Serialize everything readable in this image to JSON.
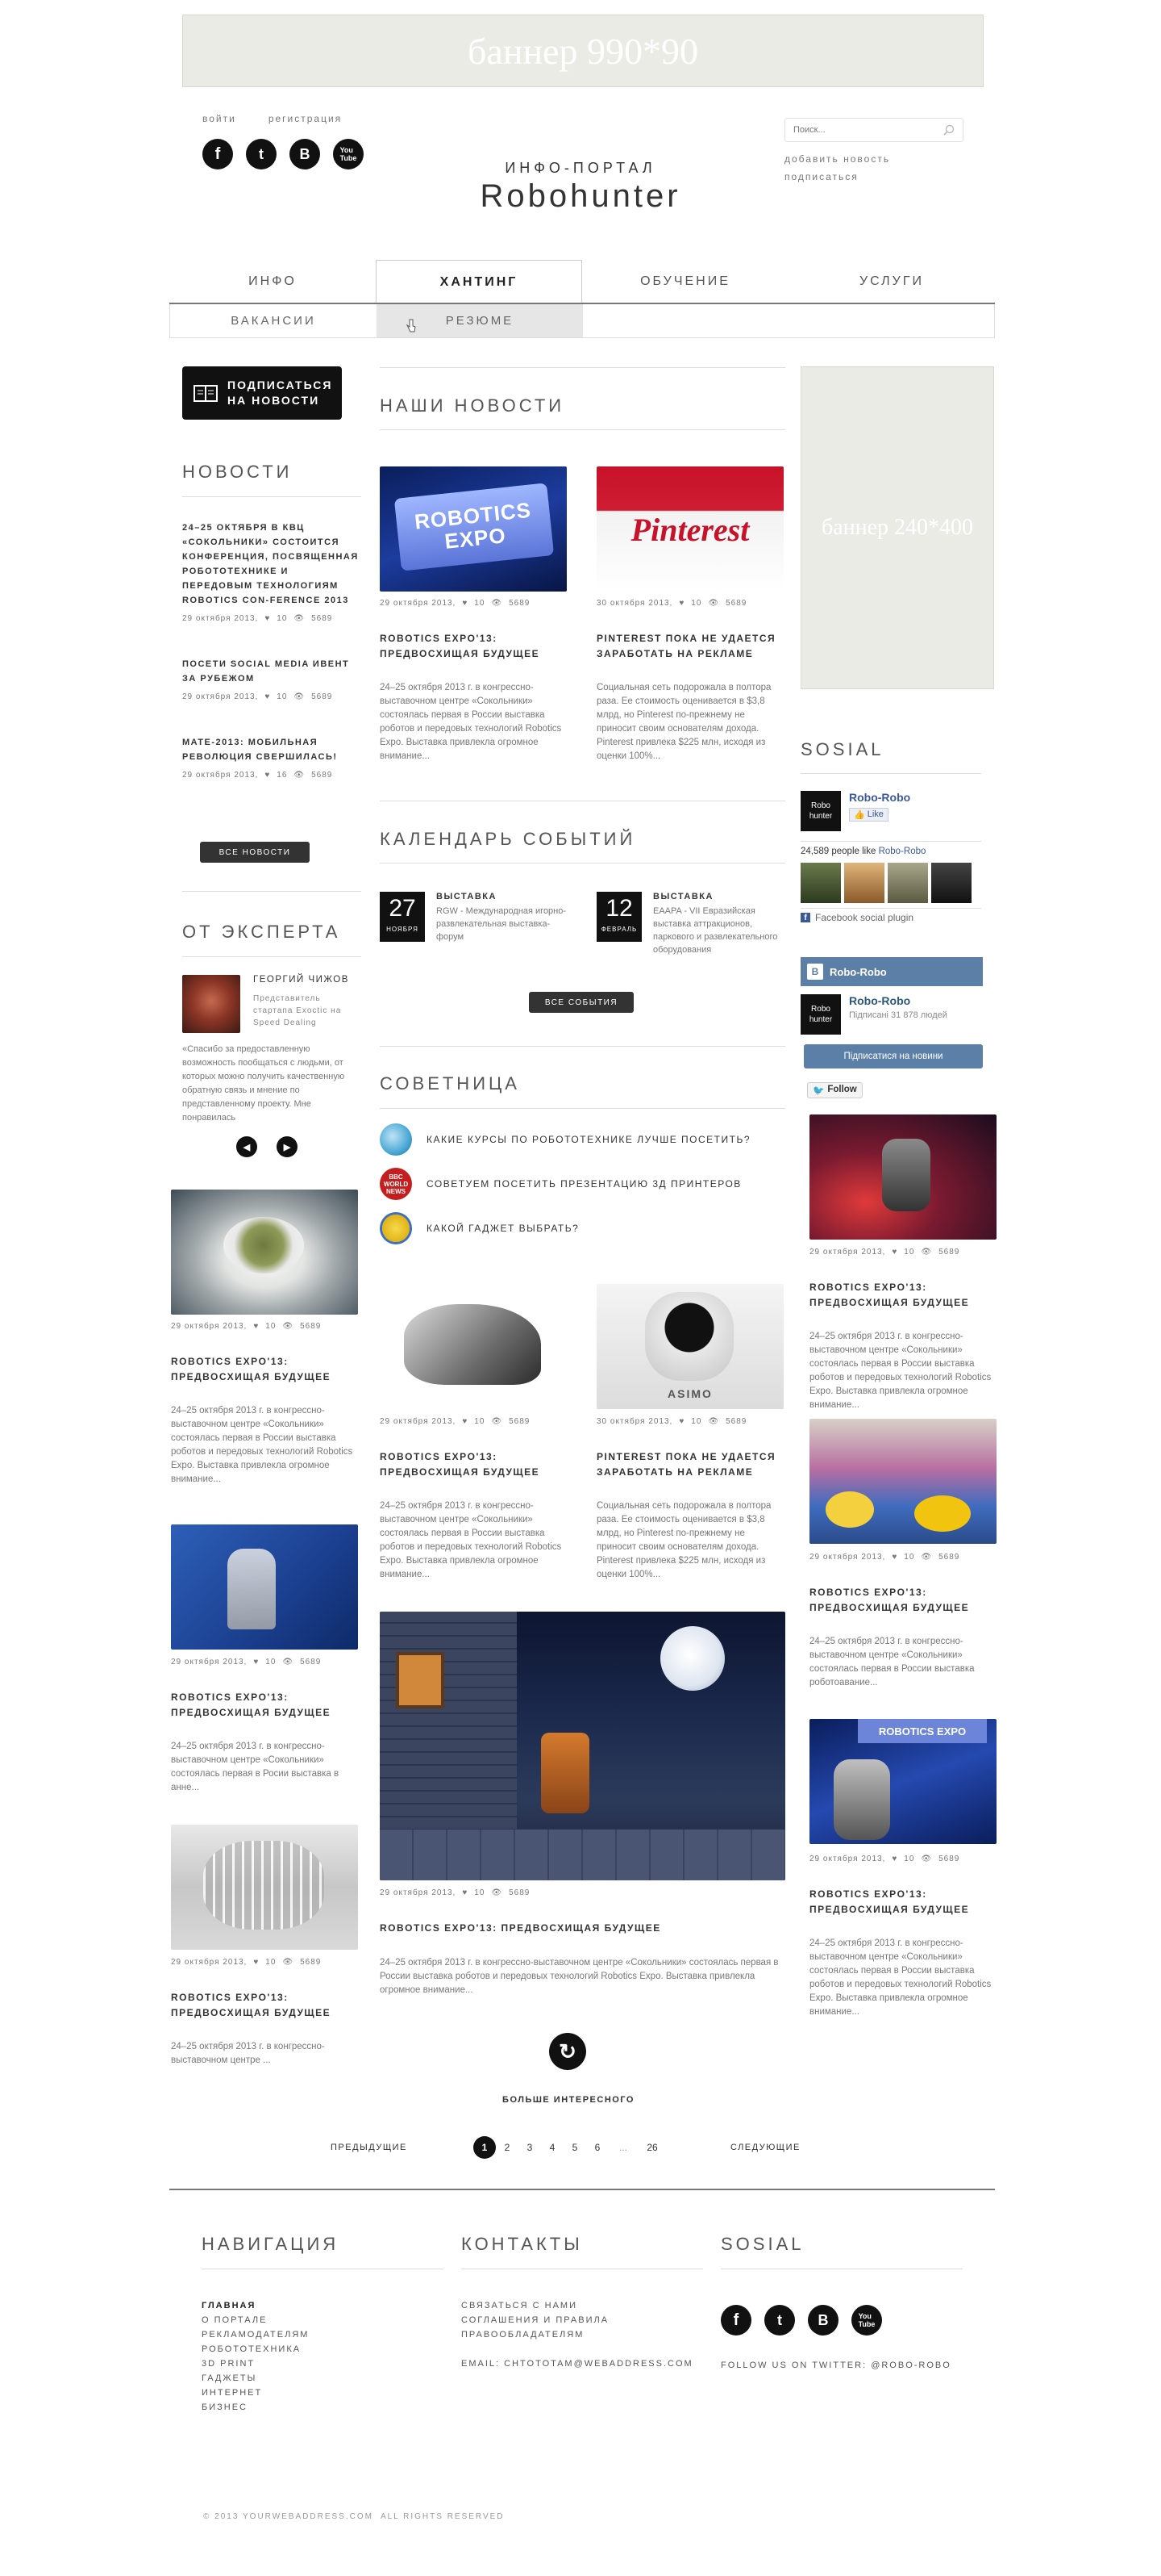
{
  "top_banner": "баннер 990*90",
  "side_banner": "баннер 240*400",
  "auth": {
    "login": "войти",
    "register": "регистрация"
  },
  "social_icons": [
    "facebook-icon",
    "twitter-icon",
    "vk-icon",
    "youtube-icon"
  ],
  "logo": {
    "sub": "ИНФО-ПОРТАЛ",
    "main": "Robohunter"
  },
  "search": {
    "placeholder": "Поиск..."
  },
  "top_links": [
    "добавить новость",
    "подписаться"
  ],
  "nav": {
    "items": [
      "ИНФО",
      "ХАНТИНГ",
      "ОБУЧЕНИЕ",
      "УСЛУГИ"
    ],
    "sub": [
      "ВАКАНСИИ",
      "РЕЗЮМЕ"
    ]
  },
  "subscribe_btn": [
    "ПОДПИСАТЬСЯ",
    "НА НОВОСТИ"
  ],
  "left": {
    "news_title": "НОВОСТИ",
    "news": [
      {
        "title": "24–25 октября в КВЦ «Сокольники» состоится конференция, посвященная робототехнике и передовым технологиям Robotics Con-ference 2013",
        "date": "29 октября 2013,",
        "likes": "10",
        "views": "5689"
      },
      {
        "title": "Посети Social Media Ивент за рубежом",
        "date": "29 октября 2013,",
        "likes": "10",
        "views": "5689"
      },
      {
        "title": "MATE-2013: мобильная революция свершилась!",
        "date": "29 октября 2013,",
        "likes": "16",
        "views": "5689"
      }
    ],
    "all_news": "ВСЕ НОВОСТИ",
    "expert_title": "ОТ ЭКСПЕРТА",
    "expert": {
      "name": "ГЕОРГИЙ ЧИЖОВ",
      "role": "Представитель стартапа Exoctic на Speed Dealing",
      "quote": "«Спасибо за предоставленную возможность пообщаться с людьми, от которых можно получить качественную обратную связь и мнение по представленному проекту. Мне понравилась"
    },
    "posts": [
      {
        "date": "29 октября 2013,",
        "likes": "10",
        "views": "5689",
        "title": "ROBOTICS EXPO'13: ПРЕДВОСХИЩАЯ БУДУЩЕЕ",
        "text": "24–25 октября 2013 г. в конгрессно-выставочном центре «Сокольники» состоялась первая в России выставка роботов и передовых технологий Robotics Expo. Выставка привлекла огромное внимание..."
      },
      {
        "date": "29 октября 2013,",
        "likes": "10",
        "views": "5689",
        "title": "ROBOTICS EXPO'13: ПРЕДВОСХИЩАЯ БУДУЩЕЕ",
        "text": "24–25 октября 2013 г. в конгрессно-выставочном центре «Сокольники» состоялась первая в Росии выставка в анне..."
      },
      {
        "date": "29 октября 2013,",
        "likes": "10",
        "views": "5689",
        "title": "ROBOTICS EXPO'13: ПРЕДВОСХИЩАЯ БУДУЩЕЕ",
        "text": "24–25 октября 2013 г. в конгрессно-выставочном центре ..."
      }
    ]
  },
  "center": {
    "news_title": "НАШИ НОВОСТИ",
    "posts": [
      {
        "date": "29 октября 2013,",
        "likes": "10",
        "views": "5689",
        "title": "ROBOTICS EXPO'13: ПРЕДВОСХИЩАЯ БУДУЩЕЕ",
        "text": "24–25 октября 2013 г. в конгрессно-выставочном центре «Сокольники» состоялась первая в России выставка роботов и передовых технологий Robotics Expo. Выставка привлекла огромное внимание...",
        "img_text": "ROBOTICS EXPO"
      },
      {
        "date": "30 октября 2013,",
        "likes": "10",
        "views": "5689",
        "title": "PINTEREST ПОКА НЕ УДАЕТСЯ ЗАРАБОТАТЬ НА РЕКЛАМЕ",
        "text": "Социальная сеть подорожала в полтора раза. Ее стоимость оценивается в $3,8 млрд, но Pinterest по-прежнему не приносит своим основателям дохода. Pinterest привлека $225 млн, исходя из оценки 100%...",
        "img_text": "Pinterest"
      }
    ],
    "calendar_title": "КАЛЕНДАРЬ СОБЫТИЙ",
    "events": [
      {
        "day": "27",
        "month": "НОЯБРЯ",
        "type": "ВЫСТАВКА",
        "desc": "RGW - Международная игорно-развлекательная выставка-форум"
      },
      {
        "day": "12",
        "month": "ФЕВРАЛЬ",
        "type": "ВЫСТАВКА",
        "desc": "EAAPA - VII Евразийская выставка аттракционов, паркового и развлекательного оборудования"
      }
    ],
    "all_events": "ВСЕ СОБЫТИЯ",
    "advice_title": "СОВЕТНИЦА",
    "advice": [
      "КАКИЕ КУРСЫ ПО РОБОТОТЕХНИКЕ ЛУЧШЕ ПОСЕТИТЬ?",
      "СОВЕТУЕМ ПОСЕТИТЬ ПРЕЗЕНТАЦИЮ 3Д ПРИНТЕРОВ",
      "КАКОЙ ГАДЖЕТ ВЫБРАТЬ?"
    ],
    "posts2": [
      {
        "date": "29 октября 2013,",
        "likes": "10",
        "views": "5689",
        "title": "ROBOTICS EXPO'13: ПРЕДВОСХИЩАЯ БУДУЩЕЕ",
        "text": "24–25 октября 2013 г. в конгрессно-выставочном центре «Сокольники» состоялась первая в России выставка роботов и передовых технологий Robotics Expo. Выставка привлекла огромное внимание..."
      },
      {
        "date": "30 октября 2013,",
        "likes": "10",
        "views": "5689",
        "title": "PINTEREST ПОКА НЕ УДАЕТСЯ ЗАРАБОТАТЬ НА РЕКЛАМЕ",
        "text": "Социальная сеть подорожала в полтора раза. Ее стоимость оценивается в $3,8 млрд, но Pinterest по-прежнему не приносит своим основателям дохода. Pinterest привлека $225 млн, исходя из оценки 100%...",
        "img_text": "ASIMO"
      }
    ],
    "big_post": {
      "date": "29 октября 2013,",
      "likes": "10",
      "views": "5689",
      "title": "ROBOTICS EXPO'13: ПРЕДВОСХИЩАЯ БУДУЩЕЕ",
      "text": "24–25 октября 2013 г. в конгрессно-выставочном центре «Сокольники» состоялась первая в России выставка роботов и передовых технологий Robotics Expo. Выставка привлекла огромное внимание..."
    },
    "more": "БОЛЬШЕ ИНТЕРЕСНОГО"
  },
  "right": {
    "sosial_title": "SOSIAL",
    "fb": {
      "name": "Robo-Robo",
      "like": "Like",
      "count": "24,589 people like",
      "link": "Robo-Robo",
      "plugin": "Facebook social plugin"
    },
    "vk": {
      "header": "Robo-Robo",
      "name": "Robo-Robo",
      "subs": "Підписані 31 878 людей",
      "btn": "Підписатися на новини"
    },
    "tw_follow": "Follow",
    "posts": [
      {
        "date": "29 октября 2013,",
        "likes": "10",
        "views": "5689",
        "title": "ROBOTICS EXPO'13: ПРЕДВОСХИЩАЯ БУДУЩЕЕ",
        "text": "24–25 октября 2013 г. в конгрессно-выставочном центре «Сокольники» состоялась первая в России выставка роботов и передовых технологий Robotics Expo. Выставка привлекла огромное внимание..."
      },
      {
        "date": "29 октября 2013,",
        "likes": "10",
        "views": "5689",
        "title": "ROBOTICS EXPO'13: ПРЕДВОСХИЩАЯ БУДУЩЕЕ",
        "text": "24–25 октября 2013 г. в конгрессно-выставочном центре «Сокольники» состоялась первая в России выставка роботоавание..."
      },
      {
        "date": "29 октября 2013,",
        "likes": "10",
        "views": "5689",
        "title": "ROBOTICS EXPO'13: ПРЕДВОСХИЩАЯ БУДУЩЕЕ",
        "text": "24–25 октября 2013 г. в конгрессно-выставочном центре «Сокольники» состоялась первая в России выставка роботов и передовых технологий Robotics Expo. Выставка привлекла огромное внимание..."
      }
    ]
  },
  "pagination": {
    "prev": "ПРЕДЫДУЩИЕ",
    "next": "СЛЕДУЮЩИЕ",
    "pages": [
      "1",
      "2",
      "3",
      "4",
      "5",
      "6",
      "...",
      "26"
    ]
  },
  "footer": {
    "nav_title": "НАВИГАЦИЯ",
    "nav": [
      "ГЛАВНАЯ",
      "О ПОРТАЛЕ",
      "РЕКЛАМОДАТЕЛЯМ",
      "РОБОТОТЕХНИКА",
      "3D PRINT",
      "ГАДЖЕТЫ",
      "ИНТЕРНЕТ",
      "БИЗНЕС"
    ],
    "contacts_title": "КОНТАКТЫ",
    "contacts": [
      "СВЯЗАТЬСЯ С НАМИ",
      "СОГЛАШЕНИЯ И ПРАВИЛА",
      "ПРАВООБЛАДАТЕЛЯМ"
    ],
    "email": "EMAIL: CHTOTOTAM@WEBADDRESS.COM",
    "sosial_title": "SOSIAL",
    "twitter": "FOLLOW US ON TWITTER: @ROBO-ROBO",
    "copyright": "© 2013 YOURWEBADDRESS.COM  ALL RIGHTS RESERVED"
  }
}
